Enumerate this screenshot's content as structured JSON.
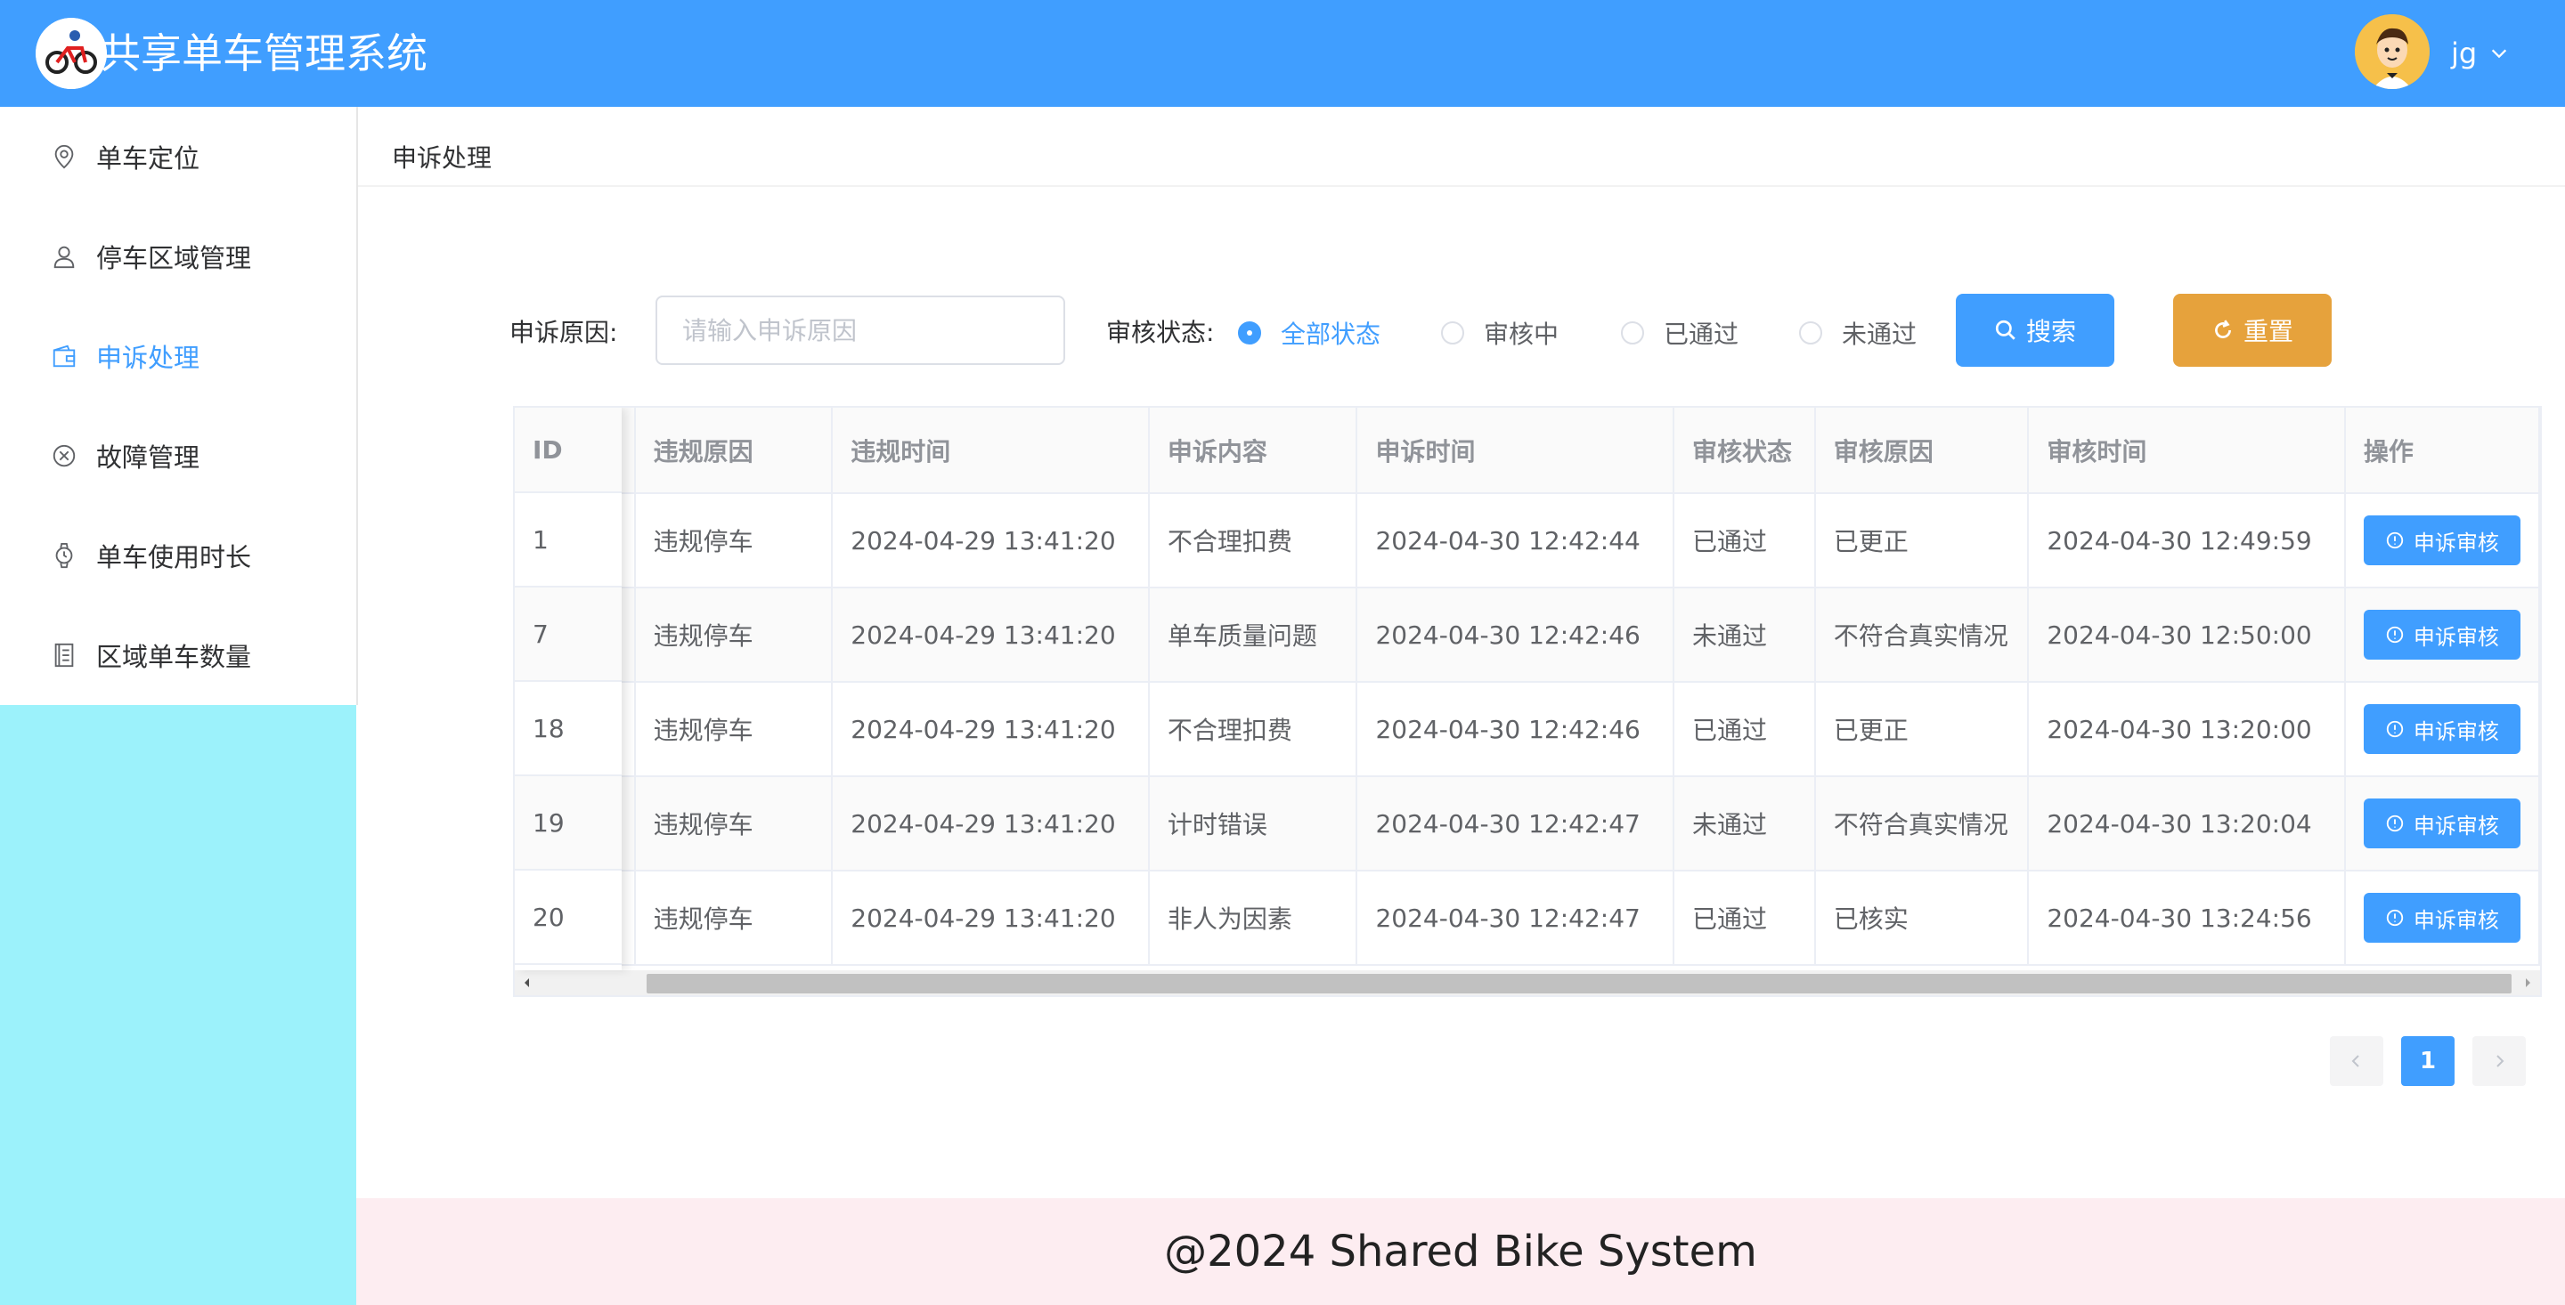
{
  "header": {
    "title": "共享单车管理系统",
    "username": "jg"
  },
  "sidebar": {
    "items": [
      {
        "label": "单车定位",
        "icon": "location-icon"
      },
      {
        "label": "停车区域管理",
        "icon": "user-icon"
      },
      {
        "label": "申诉处理",
        "icon": "wallet-icon",
        "active": true
      },
      {
        "label": "故障管理",
        "icon": "circle-close-icon"
      },
      {
        "label": "单车使用时长",
        "icon": "watch-icon"
      },
      {
        "label": "区域单车数量",
        "icon": "document-icon"
      }
    ]
  },
  "breadcrumb": "申诉处理",
  "filters": {
    "reason_label": "申诉原因:",
    "reason_placeholder": "请输入申诉原因",
    "status_label": "审核状态:",
    "status_options": [
      "全部状态",
      "审核中",
      "已通过",
      "未通过"
    ],
    "status_selected": "全部状态",
    "search_label": "搜索",
    "reset_label": "重置"
  },
  "table": {
    "columns": [
      "ID",
      "违规原因",
      "违规时间",
      "申诉内容",
      "申诉时间",
      "审核状态",
      "审核原因",
      "审核时间",
      "操作"
    ],
    "rows": [
      [
        "1",
        "违规停车",
        "2024-04-29 13:41:20",
        "不合理扣费",
        "2024-04-30 12:42:44",
        "已通过",
        "已更正",
        "2024-04-30 12:49:59"
      ],
      [
        "7",
        "违规停车",
        "2024-04-29 13:41:20",
        "单车质量问题",
        "2024-04-30 12:42:46",
        "未通过",
        "不符合真实情况",
        "2024-04-30 12:50:00"
      ],
      [
        "18",
        "违规停车",
        "2024-04-29 13:41:20",
        "不合理扣费",
        "2024-04-30 12:42:46",
        "已通过",
        "已更正",
        "2024-04-30 13:20:00"
      ],
      [
        "19",
        "违规停车",
        "2024-04-29 13:41:20",
        "计时错误",
        "2024-04-30 12:42:47",
        "未通过",
        "不符合真实情况",
        "2024-04-30 13:20:04"
      ],
      [
        "20",
        "违规停车",
        "2024-04-29 13:41:20",
        "非人为因素",
        "2024-04-30 12:42:47",
        "已通过",
        "已核实",
        "2024-04-30 13:24:56"
      ]
    ],
    "action_label": "申诉审核"
  },
  "pagination": {
    "current_page": "1"
  },
  "footer": {
    "text": "@2024 Shared Bike System"
  },
  "colors": {
    "primary": "#409eff",
    "warning": "#e6a23c",
    "sidebar_bottom": "#9cf2fb",
    "footer_bg": "#fdedf1"
  }
}
